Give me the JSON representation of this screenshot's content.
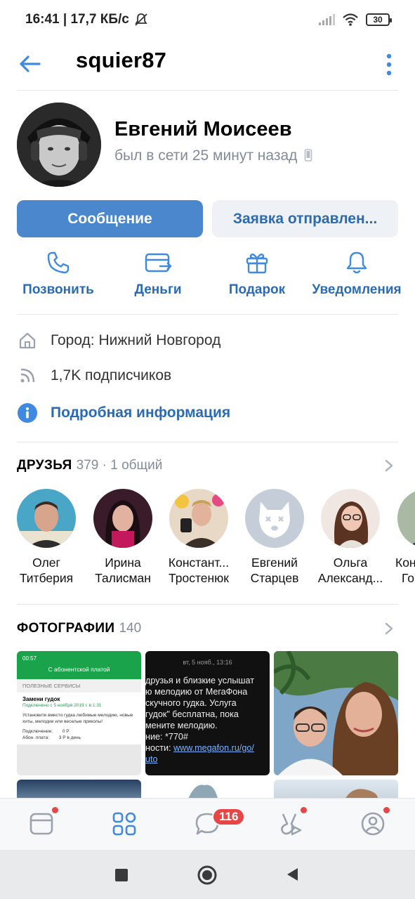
{
  "status_bar": {
    "time": "16:41",
    "net": "17,7 КБ/с",
    "battery": "30"
  },
  "header": {
    "title": "squier87"
  },
  "profile": {
    "name": "Евгений Моисеев",
    "status": "был в сети 25 минут назад"
  },
  "buttons": {
    "message": "Сообщение",
    "request": "Заявка отправлен..."
  },
  "actions": [
    {
      "label": "Позвонить",
      "icon": "phone-icon"
    },
    {
      "label": "Деньги",
      "icon": "money-icon"
    },
    {
      "label": "Подарок",
      "icon": "gift-icon"
    },
    {
      "label": "Уведомления",
      "icon": "bell-icon"
    }
  ],
  "info": {
    "city": "Город: Нижний Новгород",
    "followers": "1,7K подписчиков",
    "details": "Подробная информация"
  },
  "friends": {
    "title": "ДРУЗЬЯ",
    "count": "379 · 1 общий",
    "items": [
      {
        "first": "Олег",
        "last": "Титберия"
      },
      {
        "first": "Ирина",
        "last": "Талисман"
      },
      {
        "first": "Констант...",
        "last": "Тростенюк"
      },
      {
        "first": "Евгений",
        "last": "Старцев"
      },
      {
        "first": "Ольга",
        "last": "Александ..."
      },
      {
        "first": "Кон",
        "last": "Го"
      }
    ]
  },
  "photos": {
    "title": "ФОТОГРАФИИ",
    "count": "140",
    "p1": {
      "time": "00:57",
      "header": "С абонентской платой",
      "section": "ПОЛЕЗНЫЕ СЕРВИСЫ",
      "item": "Замени гудок",
      "sub": "Подключено с 5 ноября 2019 г. в 1:31",
      "desc": "Установите вместо гудка любимые мелодию, новые хиты, мелодии или веселые приколы!",
      "r1k": "Подключение:",
      "r1v": "0 Р",
      "r2k": "Абон. плата:",
      "r2v": "3 Р в день"
    },
    "p2": {
      "date": "вт, 5 нояб., 13:16",
      "l1": "друзья и близкие услышат",
      "l2": "ю мелодию от МегаФона",
      "l3": "скучного гудка. Услуга",
      "l4": "гудок\" бесплатна, пока",
      "l5": "мените мелодию.",
      "l6": "ние: *770#",
      "l7a": "ности:",
      "l7b": "www.megafon.ru/go/",
      "l8": "uto"
    }
  },
  "tabbar": {
    "badge": "116"
  },
  "colors": {
    "accent": "#4b87cd",
    "link": "#2a6bb3",
    "secondary": "#818c99",
    "badge": "#e64646"
  }
}
